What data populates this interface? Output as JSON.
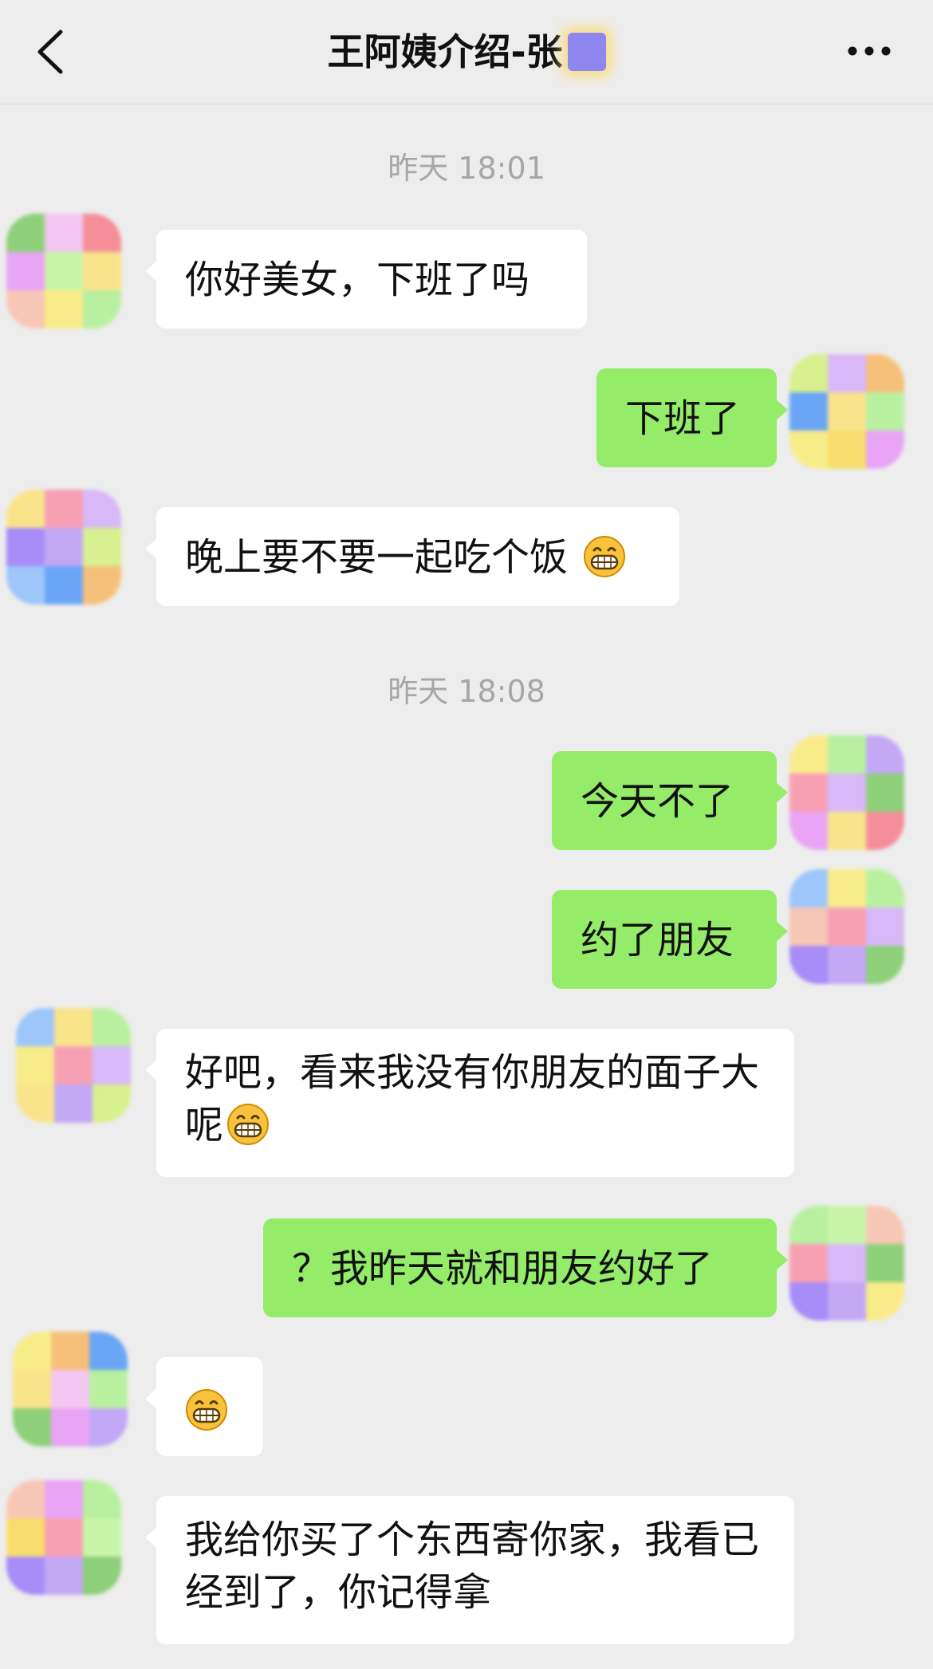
{
  "header": {
    "back_icon": "chevron-left-icon",
    "title": "王阿姨介绍-张",
    "more_icon": "more-dots-icon"
  },
  "timestamps": [
    "昨天 18:01",
    "昨天 18:08"
  ],
  "messages": [
    {
      "side": "left",
      "text": "你好美女，下班了吗"
    },
    {
      "side": "right",
      "text": "下班了"
    },
    {
      "side": "left",
      "text": "晚上要不要一起吃个饭",
      "emoji": "grin-emoji"
    },
    {
      "side": "right",
      "text": "今天不了"
    },
    {
      "side": "right",
      "text": "约了朋友"
    },
    {
      "side": "left",
      "text": "好吧，看来我没有你朋友的面子大呢",
      "emoji": "grin-emoji"
    },
    {
      "side": "right",
      "text": "？我昨天就和朋友约好了"
    },
    {
      "side": "left",
      "text": "",
      "emoji": "grin-emoji"
    },
    {
      "side": "left",
      "text": "我给你买了个东西寄你家，我看已经到了，你记得拿"
    }
  ],
  "colors": {
    "background": "#ededed",
    "self_bubble": "#95ec69",
    "other_bubble": "#ffffff"
  }
}
